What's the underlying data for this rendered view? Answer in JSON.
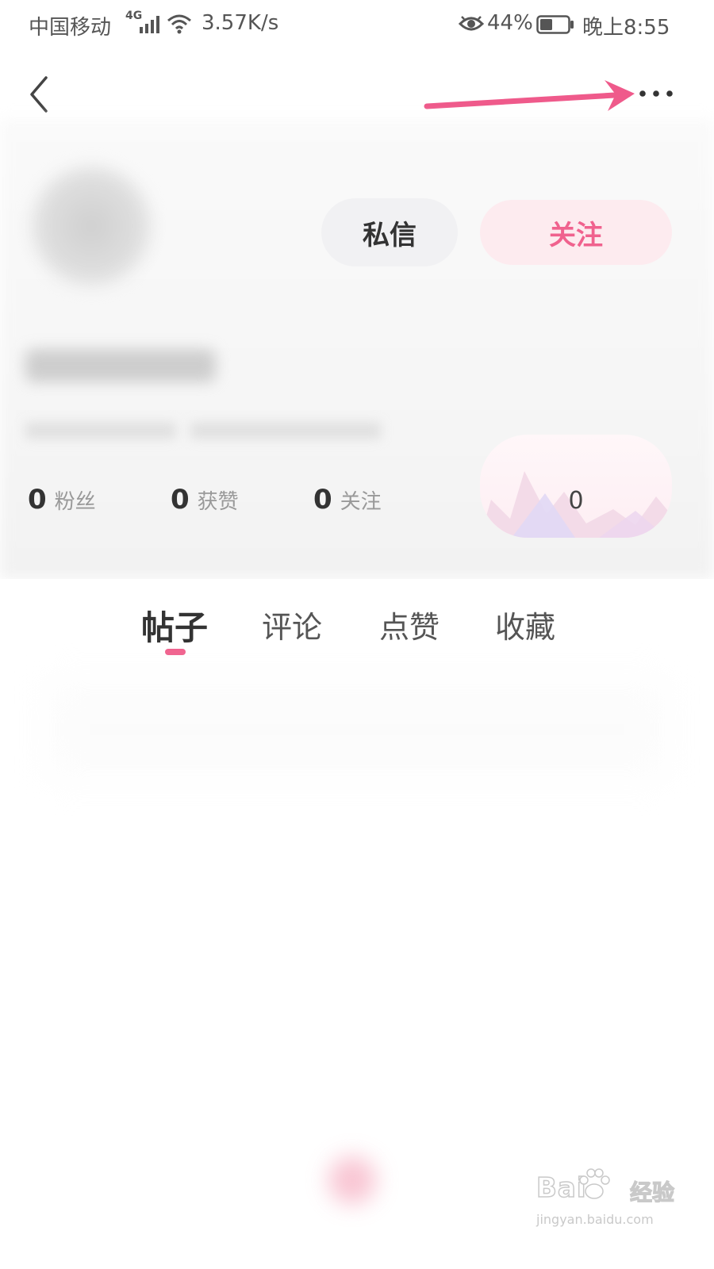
{
  "status_bar": {
    "carrier": "中国移动",
    "network": "4G",
    "speed": "3.57K/s",
    "battery_percent": "44%",
    "battery_level": 0.44,
    "time": "晚上8:55"
  },
  "nav": {
    "back_icon": "chevron-left-icon",
    "more_icon": "more-horizontal-icon"
  },
  "annotation": {
    "color": "#ef5a8b"
  },
  "profile": {
    "message_label": "私信",
    "follow_label": "关注",
    "stats": [
      {
        "value": "0",
        "label": "粉丝"
      },
      {
        "value": "0",
        "label": "获赞"
      },
      {
        "value": "0",
        "label": "关注"
      }
    ],
    "level_value": "0"
  },
  "tabs": [
    {
      "label": "帖子",
      "active": true
    },
    {
      "label": "评论",
      "active": false
    },
    {
      "label": "点赞",
      "active": false
    },
    {
      "label": "收藏",
      "active": false
    }
  ],
  "watermark": {
    "brand": "Bai",
    "brand_cn": "经验",
    "url": "jingyan.baidu.com"
  },
  "colors": {
    "accent": "#f0628e",
    "follow_bg": "#fdebef",
    "message_bg": "#f1f1f3"
  }
}
